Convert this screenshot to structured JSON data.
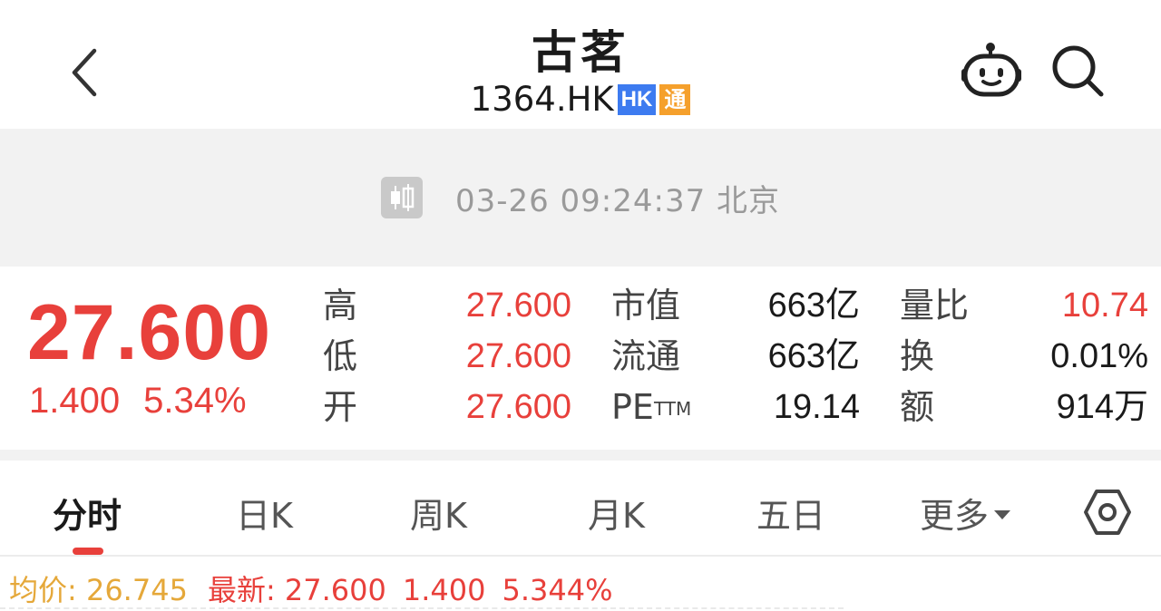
{
  "header": {
    "title": "古茗",
    "code": "1364.HK",
    "badge_market": "HK",
    "badge_connect": "通"
  },
  "status": {
    "time": "03-26 09:24:37 北京"
  },
  "quote": {
    "price": "27.600",
    "change": "1.400",
    "change_pct": "5.34%",
    "high_label": "高",
    "high": "27.600",
    "low_label": "低",
    "low": "27.600",
    "open_label": "开",
    "open": "27.600",
    "mcap_label": "市值",
    "mcap": "663亿",
    "float_label": "流通",
    "float": "663亿",
    "pe_label": "PE",
    "pe_sup": "TTM",
    "pe": "19.14",
    "vol_ratio_label": "量比",
    "vol_ratio": "10.74",
    "turnover_label": "换",
    "turnover": "0.01%",
    "amount_label": "额",
    "amount": "914万"
  },
  "tabs": [
    {
      "label": "分时",
      "active": true
    },
    {
      "label": "日K"
    },
    {
      "label": "周K"
    },
    {
      "label": "月K"
    },
    {
      "label": "五日"
    },
    {
      "label": "更多"
    }
  ],
  "legend": {
    "avg": "均价: 26.745",
    "latest": "最新: 27.600",
    "change": "1.400",
    "change_pct": "5.344%"
  },
  "colors": {
    "up": "#e8403b",
    "avg_line": "#e5a83a",
    "badge_hk": "#3d7bf0",
    "badge_connect": "#f5a02c"
  },
  "icons": [
    "back-icon",
    "robot-icon",
    "search-icon",
    "candlestick-icon",
    "settings-icon"
  ]
}
